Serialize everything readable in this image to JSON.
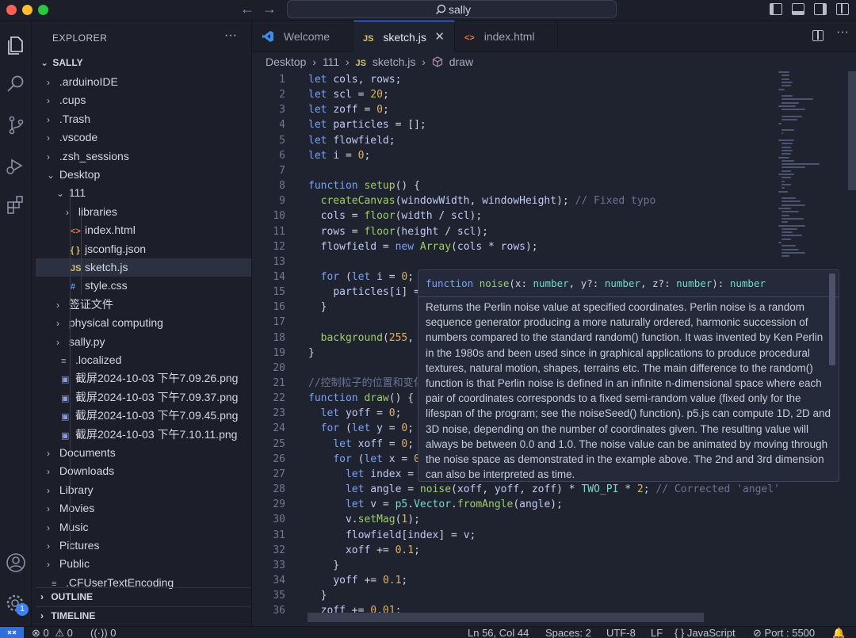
{
  "search": {
    "text": "sally"
  },
  "explorer": {
    "title": "EXPLORER",
    "root": "SALLY",
    "items": [
      {
        "label": ".arduinoIDE",
        "kind": "folder"
      },
      {
        "label": ".cups",
        "kind": "folder"
      },
      {
        "label": ".Trash",
        "kind": "folder"
      },
      {
        "label": ".vscode",
        "kind": "folder"
      },
      {
        "label": ".zsh_sessions",
        "kind": "folder"
      },
      {
        "label": "Desktop",
        "kind": "folder-open"
      },
      {
        "label": "111",
        "kind": "folder-open"
      },
      {
        "label": "libraries",
        "kind": "folder"
      },
      {
        "label": "index.html",
        "kind": "html"
      },
      {
        "label": "jsconfig.json",
        "kind": "json"
      },
      {
        "label": "sketch.js",
        "kind": "js"
      },
      {
        "label": "style.css",
        "kind": "css"
      },
      {
        "label": "签证文件",
        "kind": "folder"
      },
      {
        "label": "physical computing",
        "kind": "folder"
      },
      {
        "label": "sally.py",
        "kind": "folder"
      },
      {
        "label": ".localized",
        "kind": "file"
      },
      {
        "label": "截屏2024-10-03 下午7.09.26.png",
        "kind": "image"
      },
      {
        "label": "截屏2024-10-03 下午7.09.37.png",
        "kind": "image"
      },
      {
        "label": "截屏2024-10-03 下午7.09.45.png",
        "kind": "image"
      },
      {
        "label": "截屏2024-10-03 下午7.10.11.png",
        "kind": "image"
      },
      {
        "label": "Documents",
        "kind": "folder"
      },
      {
        "label": "Downloads",
        "kind": "folder"
      },
      {
        "label": "Library",
        "kind": "folder"
      },
      {
        "label": "Movies",
        "kind": "folder"
      },
      {
        "label": "Music",
        "kind": "folder"
      },
      {
        "label": "Pictures",
        "kind": "folder"
      },
      {
        "label": "Public",
        "kind": "folder"
      },
      {
        "label": ".CFUserTextEncoding",
        "kind": "file"
      }
    ],
    "outline": "OUTLINE",
    "timeline": "TIMELINE",
    "accounts_badge": "1"
  },
  "tabs": [
    {
      "label": "Welcome",
      "icon": "vscode-icon"
    },
    {
      "label": "sketch.js",
      "icon": "JS",
      "active": true
    },
    {
      "label": "index.html",
      "icon": "<>"
    }
  ],
  "breadcrumb": [
    "Desktop",
    "111",
    "sketch.js",
    "draw"
  ],
  "code_lines": [
    "let cols, rows;",
    "let scl = 20;",
    "let zoff = 0;",
    "let particles = [];",
    "let flowfield;",
    "let i = 0;",
    "",
    "function setup() {",
    "  createCanvas(windowWidth, windowHeight); // Fixed typo",
    "  cols = floor(width / scl);",
    "  rows = floor(height / scl);",
    "  flowfield = new Array(cols * rows);",
    "",
    "  for (let i = 0;",
    "    particles[i] =",
    "  }",
    "",
    "  background(255,",
    "}",
    "",
    "//控制粒子的位置和变化",
    "function draw() {",
    "  let yoff = 0;",
    "  for (let y = 0;",
    "    let xoff = 0;",
    "    for (let x = 0",
    "      let index =",
    "      let angle = noise(xoff, yoff, zoff) * TWO_PI * 2; // Corrected 'angel'",
    "      let v = p5.Vector.fromAngle(angle);",
    "      v.setMag(1);",
    "      flowfield[index] = v;",
    "      xoff += 0.1;",
    "    }",
    "    yoff += 0.1;",
    "  }",
    "  zoff += 0.01;"
  ],
  "hover": {
    "signature": "function noise(x: number, y?: number, z?: number): number",
    "doc": "Returns the Perlin noise value at specified coordinates. Perlin noise is a random sequence generator producing a more naturally ordered, harmonic succession of numbers compared to the standard random() function. It was invented by Ken Perlin in the 1980s and been used since in graphical applications to produce procedural textures, natural motion, shapes, terrains etc. The main difference to the random() function is that Perlin noise is defined in an infinite n-dimensional space where each pair of coordinates corresponds to a fixed semi-random value (fixed only for the lifespan of the program; see the noiseSeed() function). p5.js can compute 1D, 2D and 3D noise, depending on the number of coordinates given. The resulting value will always be between 0.0 and 1.0. The noise value can be animated by moving through the noise space as demonstrated in the example above. The 2nd and 3rd dimension can also be interpreted as time."
  },
  "status": {
    "errors": "0",
    "warnings": "0",
    "ports": "0",
    "position": "Ln 56, Col 44",
    "spaces": "Spaces: 2",
    "encoding": "UTF-8",
    "eol": "LF",
    "language": "JavaScript",
    "port": "Port : 5500"
  },
  "colors": {
    "accent": "#2f6fdc",
    "keyword": "#7aa2f7",
    "function": "#9ece6a",
    "comment": "#6b7394"
  }
}
